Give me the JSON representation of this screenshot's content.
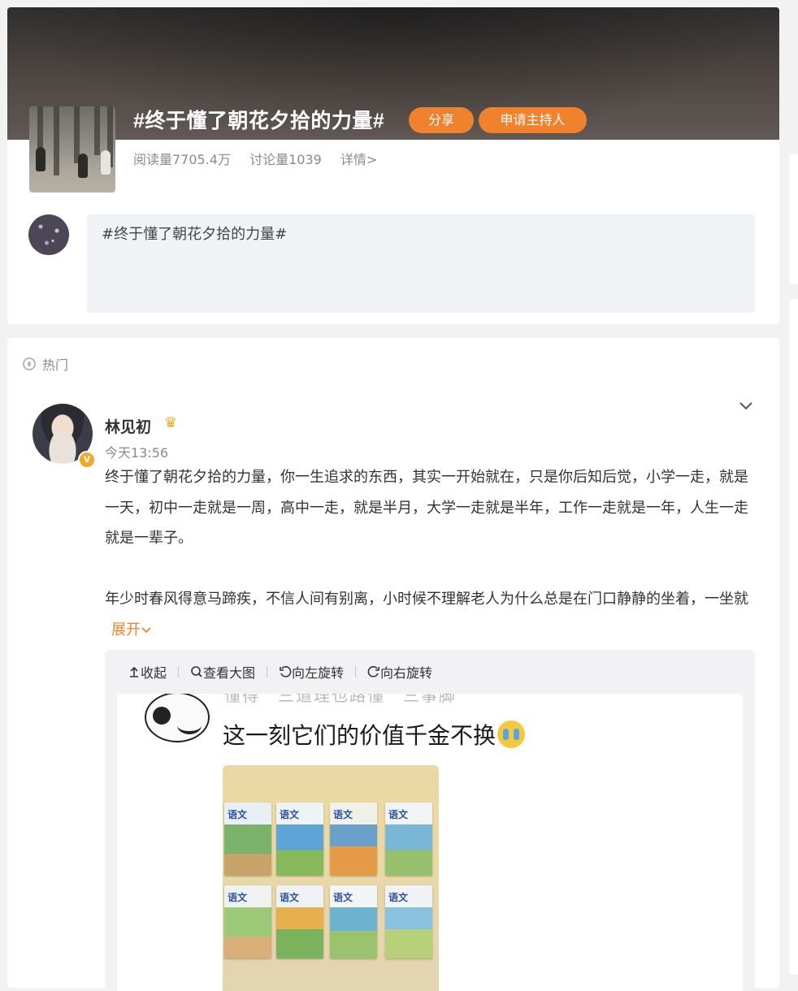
{
  "topic": {
    "title": "#终于懂了朝花夕拾的力量#",
    "share_label": "分享",
    "host_label": "申请主持人",
    "reads": "阅读量7705.4万",
    "discussions": "讨论量1039",
    "details_link": "详情>",
    "composer_text": "#终于懂了朝花夕拾的力量#"
  },
  "feed": {
    "section_label": "热门",
    "post": {
      "author": "林见初",
      "time": "今天13:56",
      "paragraph1": "终于懂了朝花夕拾的力量，你一生追求的东西，其实一开始就在，只是你后知后觉，小学一走，就是一天，初中一走就是一周，高中一走，就是半月，大学一走就是半年，工作一走就是一年，人生一走就是一辈子。",
      "paragraph2": "年少时春风得意马蹄疾，不信人间有别离，小时候不理解老人为什么总是在门口静静的坐着，一坐就",
      "expand_label": "展开"
    },
    "viewer": {
      "tools": {
        "collapse": "收起",
        "view_large": "查看大图",
        "rotate_left": "向左旋转",
        "rotate_right": "向右旋转"
      },
      "image": {
        "faded_text": "懂得　三道理也路懂　三事脚",
        "caption": "这一刻它们的价值千金不换",
        "book_label": "语文"
      }
    }
  },
  "colors": {
    "accent_orange": "#f0822e",
    "verified_gold": "#f5a623",
    "muted_text": "#8a8a8a"
  },
  "icons": [
    "crown-icon",
    "chevron-down-icon",
    "hot-icon",
    "collapse-icon",
    "zoom-icon",
    "rotate-left-icon",
    "rotate-right-icon",
    "crying-emoji"
  ]
}
